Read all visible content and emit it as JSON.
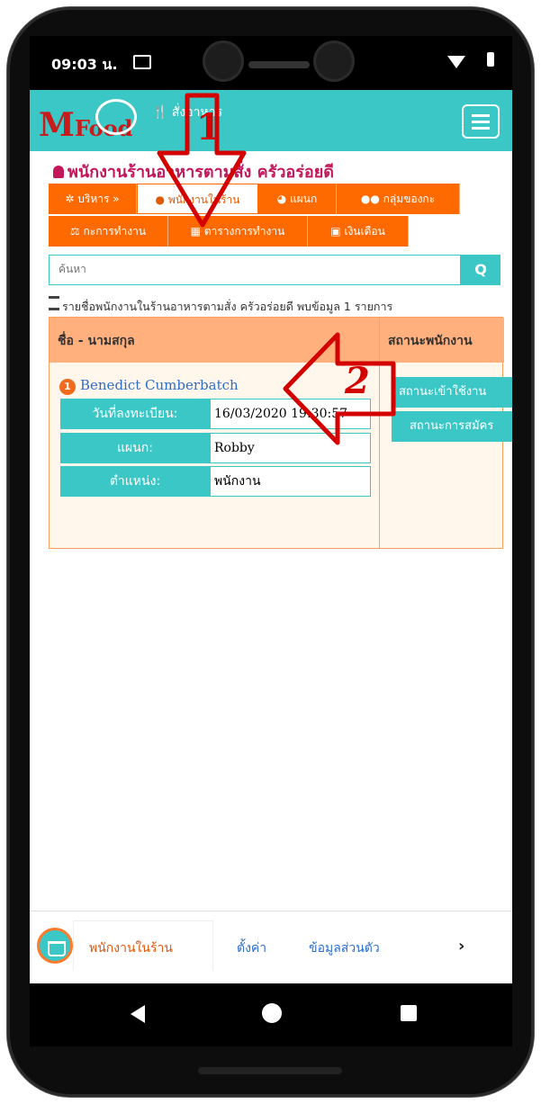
{
  "status_bar": {
    "time": "09:03 น."
  },
  "app_bar": {
    "logo_m": "M",
    "logo_food": "Food",
    "title": "สั่งอาหาร"
  },
  "page": {
    "title": "พนักงานร้านอาหารตามสั่ง ครัวอร่อยดี"
  },
  "tabs": [
    {
      "label": "บริหาร »"
    },
    {
      "label": "พนักงานในร้าน"
    },
    {
      "label": "แผนก"
    },
    {
      "label": "กลุ่มของกะ"
    },
    {
      "label": "กะการทำงาน"
    },
    {
      "label": "ตารางการทำงาน"
    },
    {
      "label": "เงินเดือน"
    }
  ],
  "search": {
    "placeholder": "ค้นหา",
    "button": "Q"
  },
  "list_info": "รายชื่อพนักงานในร้านอาหารตามสั่ง ครัวอร่อยดี พบข้อมูล 1 รายการ",
  "table": {
    "headers": [
      "ชื่อ - นามสกุล",
      "สถานะพนักงาน"
    ],
    "rows": [
      {
        "num": "1",
        "name": "Benedict Cumberbatch",
        "details": [
          {
            "label": "วันที่ลงทะเบียน:",
            "value": "16/03/2020 19:30:57"
          },
          {
            "label": "แผนก:",
            "value": "Robby"
          },
          {
            "label": "ตำแหน่ง:",
            "value": "พนักงาน"
          }
        ],
        "status_buttons": [
          "สถานะเข้าใช้งาน",
          "สถานะการสมัคร"
        ]
      }
    ]
  },
  "bottom_nav": [
    {
      "label": "พนักงานในร้าน"
    },
    {
      "label": "ตั้งค่า"
    },
    {
      "label": "ข้อมูลส่วนตัว"
    },
    {
      "label": "›"
    }
  ],
  "annotations": {
    "arrow1_number": "1",
    "arrow2_number": "2"
  },
  "colors": {
    "teal": "#3cc7c7",
    "orange": "#ff6a00",
    "title": "#c2185b",
    "logo_red": "#c81b1b",
    "arrow_red": "#d40000"
  }
}
